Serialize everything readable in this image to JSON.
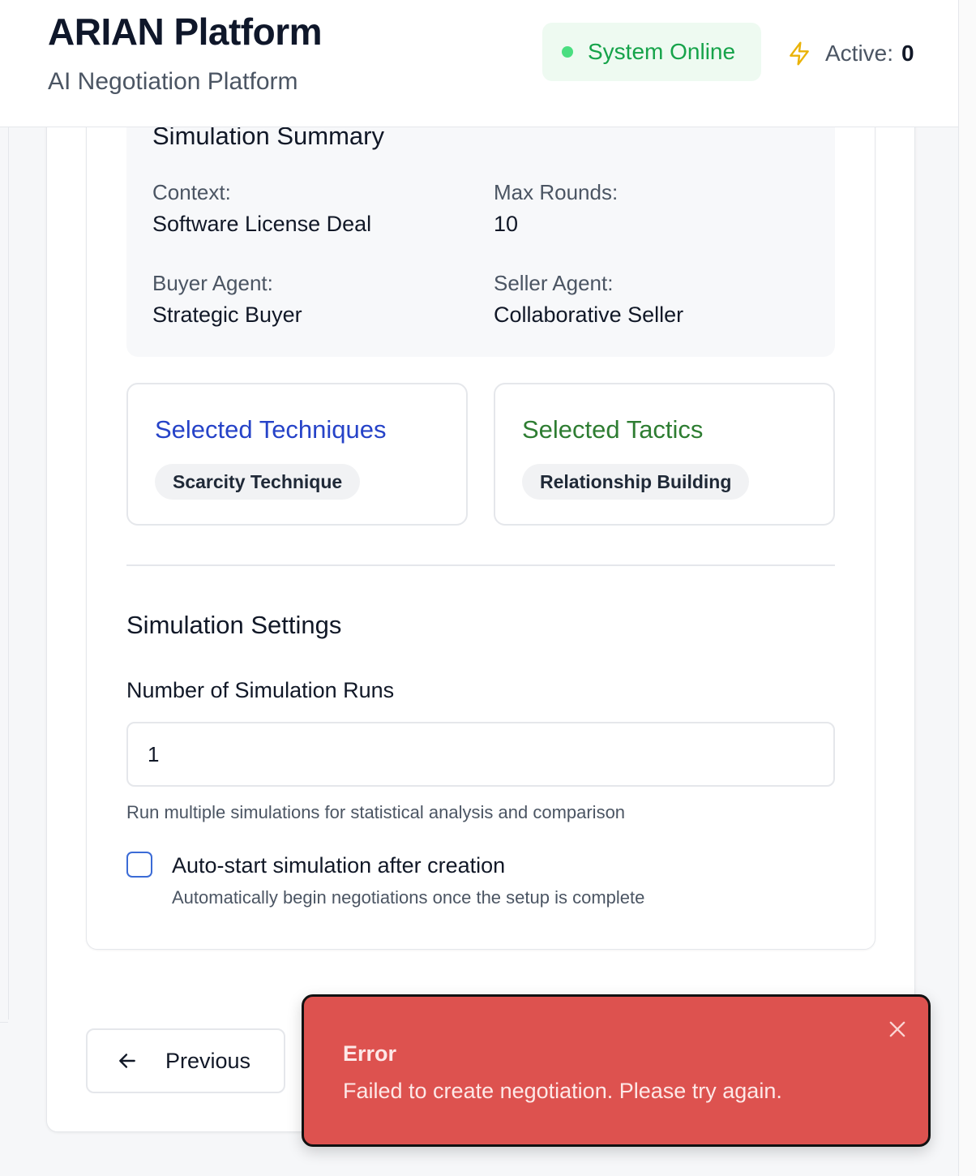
{
  "header": {
    "title": "ARIAN Platform",
    "subtitle": "AI Negotiation Platform",
    "status_text": "System Online",
    "status_color": "#16a34a",
    "active_label": "Active:",
    "active_value": "0",
    "active_icon": "lightning-icon"
  },
  "summary": {
    "title": "Simulation Summary",
    "context_label": "Context:",
    "context_value": "Software License Deal",
    "max_rounds_label": "Max Rounds:",
    "max_rounds_value": "10",
    "buyer_label": "Buyer Agent:",
    "buyer_value": "Strategic Buyer",
    "seller_label": "Seller Agent:",
    "seller_value": "Collaborative Seller"
  },
  "techniques": {
    "title": "Selected Techniques",
    "items": [
      "Scarcity Technique"
    ],
    "accent": "#2643c8"
  },
  "tactics": {
    "title": "Selected Tactics",
    "items": [
      "Relationship Building"
    ],
    "accent": "#2e7d32"
  },
  "settings": {
    "title": "Simulation Settings",
    "runs_label": "Number of Simulation Runs",
    "runs_value": "1",
    "runs_help": "Run multiple simulations for statistical analysis and comparison",
    "autostart_label": "Auto-start simulation after creation",
    "autostart_help": "Automatically begin negotiations once the setup is complete",
    "autostart_checked": false
  },
  "footer": {
    "previous_label": "Previous",
    "previous_icon": "arrow-left-icon"
  },
  "toast": {
    "title": "Error",
    "message": "Failed to create negotiation. Please try again.",
    "close_icon": "close-icon",
    "color": "#dd524f"
  }
}
